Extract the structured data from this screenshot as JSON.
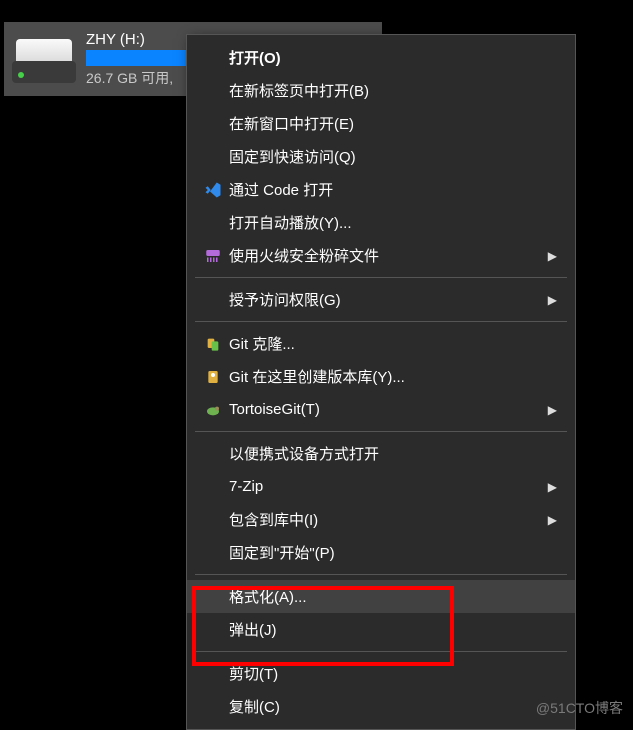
{
  "drive": {
    "name": "ZHY (H:)",
    "status": "26.7 GB 可用,"
  },
  "menu": {
    "open": "打开(O)",
    "open_new_tab": "在新标签页中打开(B)",
    "open_new_window": "在新窗口中打开(E)",
    "pin_quick_access": "固定到快速访问(Q)",
    "open_with_code": "通过 Code 打开",
    "autoplay": "打开自动播放(Y)...",
    "huorong_shred": "使用火绒安全粉碎文件",
    "grant_access": "授予访问权限(G)",
    "git_clone": "Git 克隆...",
    "git_create_repo": "Git 在这里创建版本库(Y)...",
    "tortoisegit": "TortoiseGit(T)",
    "open_portable": "以便携式设备方式打开",
    "seven_zip": "7-Zip",
    "include_library": "包含到库中(I)",
    "pin_start": "固定到\"开始\"(P)",
    "format": "格式化(A)...",
    "eject": "弹出(J)",
    "cut": "剪切(T)",
    "copy": "复制(C)"
  },
  "watermark": "@51CTO博客"
}
